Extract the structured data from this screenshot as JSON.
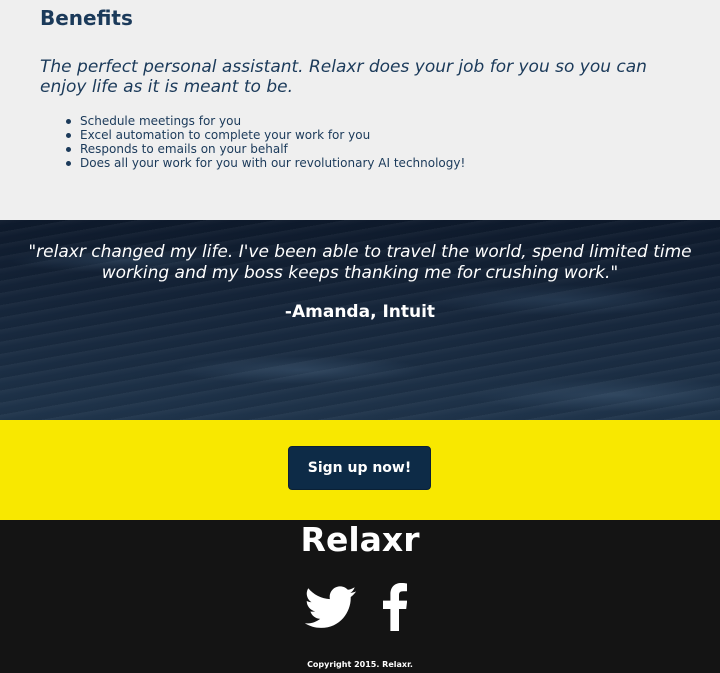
{
  "benefits": {
    "heading": "Benefits",
    "tagline": "The perfect personal assistant. Relaxr does your job for you so you can enjoy life as it is meant to be.",
    "items": [
      "Schedule meetings for you",
      "Excel automation to complete your work for you",
      "Responds to emails on your behalf",
      "Does all your work for you with our revolutionary AI technology!"
    ]
  },
  "testimonial": {
    "quote": "\"relaxr changed my life. I've been able to travel the world, spend limited time working and my boss keeps thanking me for crushing work.\"",
    "author": "-Amanda, Intuit"
  },
  "cta": {
    "button_label": "Sign up now!"
  },
  "footer": {
    "brand": "Relaxr",
    "social_icons": [
      "twitter-icon",
      "facebook-icon"
    ],
    "copyright": "Copyright 2015. Relaxr."
  },
  "colors": {
    "navy": "#1b3a5a",
    "cta_yellow": "#f8e800",
    "button_navy": "#0d2b47",
    "footer_black": "#141414"
  }
}
